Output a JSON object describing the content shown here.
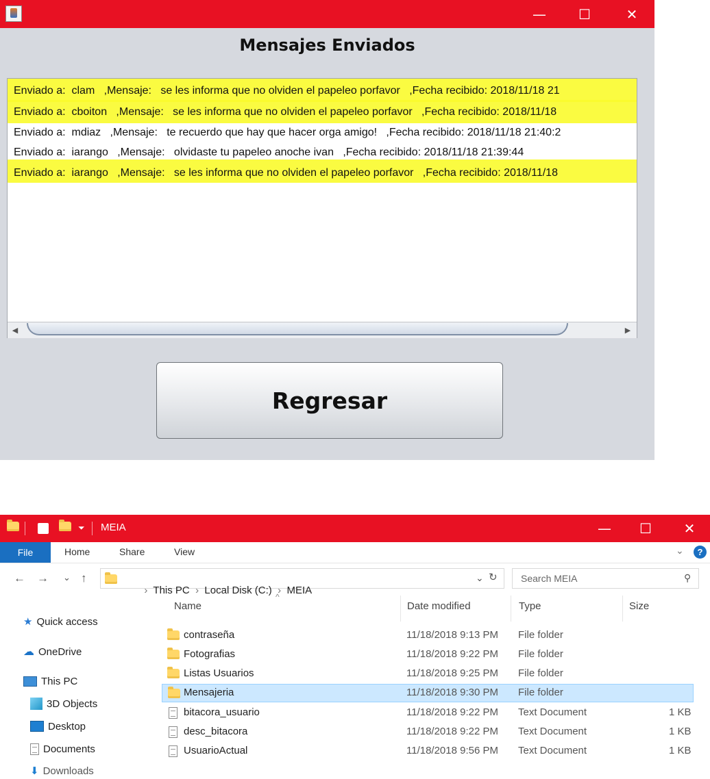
{
  "java_window": {
    "heading": "Mensajes Enviados",
    "controls": {
      "minimize": "—",
      "maximize": "☐",
      "close": "✕"
    },
    "messages": [
      {
        "text": "Enviado a:  clam   ,Mensaje:   se les informa que no olviden el papeleo porfavor   ,Fecha recibido: 2018/11/18 21",
        "highlighted": true
      },
      {
        "text": "Enviado a:  cboiton   ,Mensaje:   se les informa que no olviden el papeleo porfavor   ,Fecha recibido: 2018/11/18",
        "highlighted": true
      },
      {
        "text": "Enviado a:  mdiaz   ,Mensaje:   te recuerdo que hay que hacer orga amigo!   ,Fecha recibido: 2018/11/18 21:40:2",
        "highlighted": false
      },
      {
        "text": "Enviado a:  iarango   ,Mensaje:   olvidaste tu papeleo anoche ivan   ,Fecha recibido: 2018/11/18 21:39:44",
        "highlighted": false
      },
      {
        "text": "Enviado a:  iarango   ,Mensaje:   se les informa que no olviden el papeleo porfavor   ,Fecha recibido: 2018/11/18",
        "highlighted": true
      }
    ],
    "scroll_left": "◀",
    "scroll_right": "▶",
    "back_button": "Regresar",
    "highlight_color": "#fafb2c"
  },
  "explorer": {
    "title": "MEIA",
    "controls": {
      "minimize": "—",
      "maximize": "☐",
      "close": "✕"
    },
    "ribbon_tabs": [
      "File",
      "Home",
      "Share",
      "View"
    ],
    "help": "?",
    "nav": {
      "back": "←",
      "forward": "→",
      "recent": "⌄",
      "up": "↑",
      "refresh": "↻",
      "dropdown": "⌄"
    },
    "breadcrumb": [
      "This PC",
      "Local Disk (C:)",
      "MEIA"
    ],
    "search_placeholder": "Search MEIA",
    "nav_pane": [
      {
        "label": "Quick access",
        "icon": "star-icon"
      },
      {
        "label": "OneDrive",
        "icon": "cloud-icon"
      },
      {
        "label": "This PC",
        "icon": "computer-icon"
      },
      {
        "label": "3D Objects",
        "icon": "cube-icon"
      },
      {
        "label": "Desktop",
        "icon": "desktop-icon"
      },
      {
        "label": "Documents",
        "icon": "documents-icon"
      },
      {
        "label": "Downloads",
        "icon": "download-icon"
      }
    ],
    "columns": {
      "name": "Name",
      "date": "Date modified",
      "type": "Type",
      "size": "Size"
    },
    "files": [
      {
        "name": "contraseña",
        "date": "11/18/2018 9:13 PM",
        "type": "File folder",
        "size": "",
        "kind": "folder",
        "selected": false
      },
      {
        "name": "Fotografias",
        "date": "11/18/2018 9:22 PM",
        "type": "File folder",
        "size": "",
        "kind": "folder",
        "selected": false
      },
      {
        "name": "Listas Usuarios",
        "date": "11/18/2018 9:25 PM",
        "type": "File folder",
        "size": "",
        "kind": "folder",
        "selected": false
      },
      {
        "name": "Mensajeria",
        "date": "11/18/2018 9:30 PM",
        "type": "File folder",
        "size": "",
        "kind": "folder",
        "selected": true
      },
      {
        "name": "bitacora_usuario",
        "date": "11/18/2018 9:22 PM",
        "type": "Text Document",
        "size": "1 KB",
        "kind": "doc",
        "selected": false
      },
      {
        "name": "desc_bitacora",
        "date": "11/18/2018 9:22 PM",
        "type": "Text Document",
        "size": "1 KB",
        "kind": "doc",
        "selected": false
      },
      {
        "name": "UsuarioActual",
        "date": "11/18/2018 9:56 PM",
        "type": "Text Document",
        "size": "1 KB",
        "kind": "doc",
        "selected": false
      }
    ],
    "accent_color": "#e81123",
    "ribbon_accent": "#1a6fc1"
  }
}
